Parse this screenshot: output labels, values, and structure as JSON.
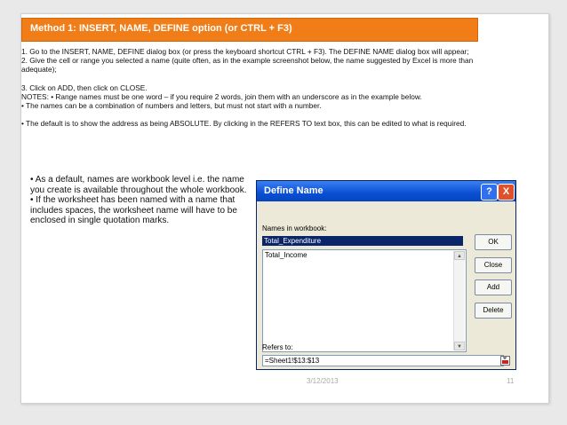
{
  "banner": {
    "title": "Method 1: INSERT, NAME, DEFINE option (or CTRL + F3)"
  },
  "body": {
    "p1": "1. Go to the INSERT, NAME, DEFINE dialog box (or press the keyboard shortcut  CTRL + F3). The DEFINE NAME dialog box will appear;",
    "p2": "2. Give the cell or range you selected a name (quite often, as in the example  screenshot below, the name suggested by Excel is more than adequate);",
    "p3": "3. Click on ADD, then click on CLOSE.",
    "p4": "NOTES: • Range names must be one word – if you require 2 words, join them with an underscore as in the example below.",
    "p5": "• The names can be a combination of numbers and letters, but must not start with a number.",
    "p6": "• The default is to show the address as being ABSOLUTE. By clicking in the REFERS TO text box, this can be edited to what is required."
  },
  "bullets": {
    "b1": "• As a default, names are workbook level i.e. the name you create is available throughout the whole workbook.",
    "b2": "• If the worksheet has been named with a name that includes spaces, the worksheet name will have to be enclosed in single quotation marks."
  },
  "dialog": {
    "title": "Define Name",
    "help": "?",
    "close": "X",
    "names_label": "Names in workbook:",
    "name_value": "Total_Expenditure",
    "list_items": [
      "Total_Expenditure",
      "Total_Income"
    ],
    "buttons": {
      "ok": "OK",
      "close": "Close",
      "add": "Add",
      "delete": "Delete"
    },
    "refers_label": "Refers to:",
    "refers_value": "=Sheet1!$13:$13"
  },
  "footer": {
    "date": "3/12/2013",
    "page": "11"
  }
}
